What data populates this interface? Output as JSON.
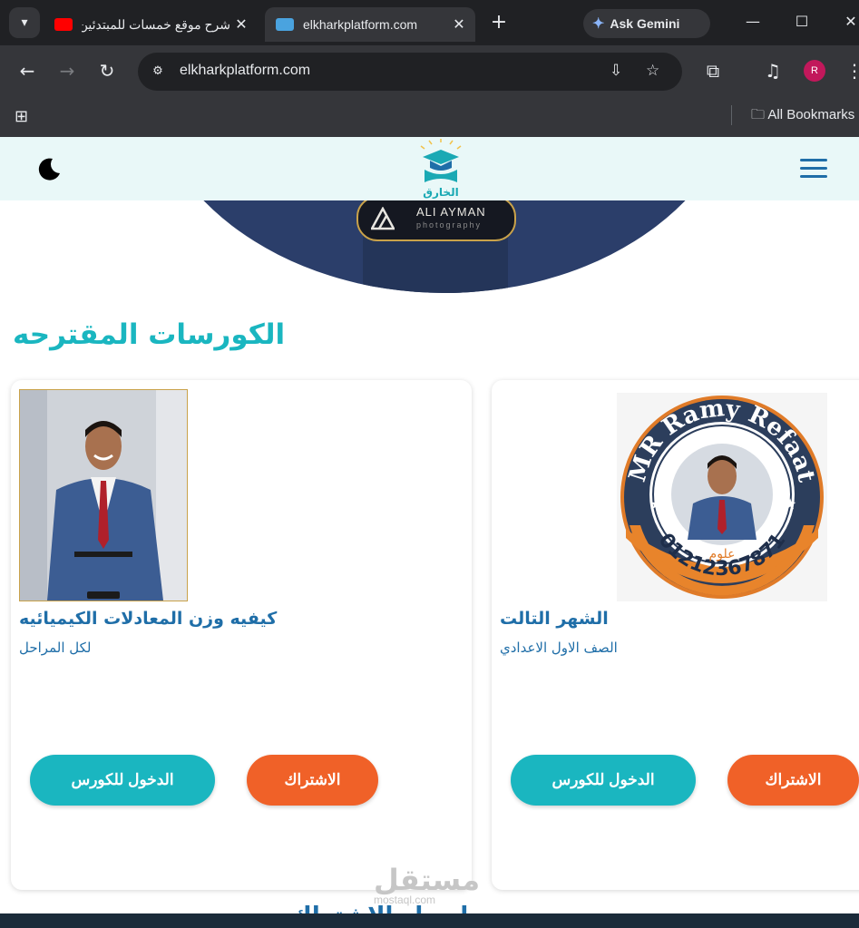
{
  "browser": {
    "tabs": [
      {
        "title": "شرح موقع خمسات للمبتدئين",
        "favicon_color": "#ff0000",
        "active": false
      },
      {
        "title": "elkharkplatform.com",
        "favicon_color": "#4aa3df",
        "active": true
      }
    ],
    "gemini_label": "Ask Gemini",
    "address": "elkharkplatform.com",
    "profile_initial": "R",
    "bookmarks_label": "All Bookmarks"
  },
  "site": {
    "logo_text": "الخارق",
    "hero_badge": {
      "title": "ALI AYMAN",
      "subtitle": "photography"
    },
    "section_title": "الكورسات المقترحه",
    "courses": [
      {
        "title": "كيفيه وزن المعادلات الكيميائيه",
        "subtitle": "لكل المراحل",
        "enter_label": "الدخول للكورس",
        "subscribe_label": "الاشتراك"
      },
      {
        "title": "الشهر التالت",
        "subtitle": "الصف الاول الاعدادي",
        "enter_label": "الدخول للكورس",
        "subscribe_label": "الاشتراك",
        "logo": {
          "ring_text": "MR Ramy Refaat",
          "subject": "علوم",
          "phone": "01212367871"
        }
      }
    ],
    "bottom_heading": "اسعار الاشتراك",
    "watermark": "مستقل",
    "watermark_url": "mostaql.com"
  },
  "colors": {
    "teal": "#1ab6c0",
    "orange": "#f06128",
    "blue": "#1f6ea8",
    "header_bg": "#e9f8f8"
  }
}
